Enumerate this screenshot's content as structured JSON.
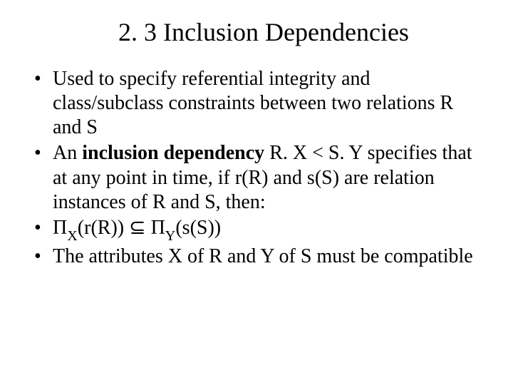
{
  "title": "2. 3 Inclusion Dependencies",
  "bullets": {
    "b1": "Used to specify referential integrity and class/subclass constraints between two relations R and S",
    "b2_pre": "An ",
    "b2_bold": "inclusion dependency",
    "b2_post": " R. X < S. Y specifies that at any point in time, if r(R) and s(S) are relation instances of R and S, then:",
    "b3_pi1": "Π",
    "b3_sub1": "X",
    "b3_mid1": "(r(R)) ",
    "b3_subset": "⊆",
    "b3_sp": " ",
    "b3_pi2": "Π",
    "b3_sub2": "Y",
    "b3_mid2": "(s(S))",
    "b4": "The attributes X of R and Y of S must be compatible"
  }
}
